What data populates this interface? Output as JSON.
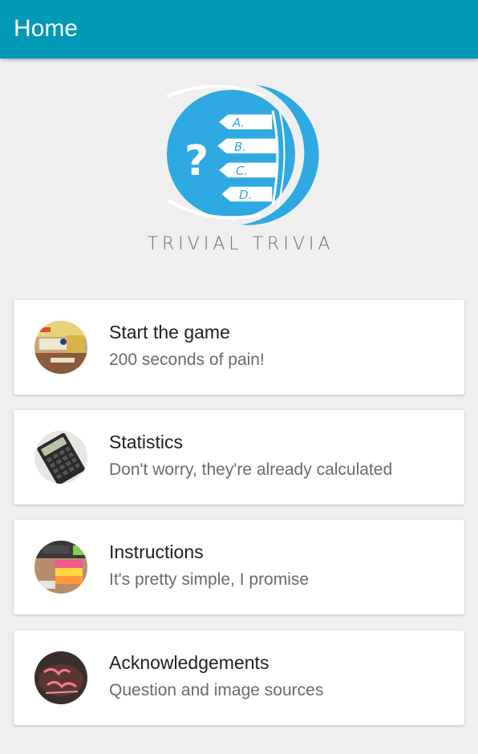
{
  "appbar": {
    "title": "Home",
    "color": "#0099b8"
  },
  "logo": {
    "text": "TRIVIAL TRIVIA",
    "question_mark": "?",
    "options": [
      "A.",
      "B.",
      "C.",
      "D."
    ],
    "color": "#2fa9e1"
  },
  "menu": {
    "items": [
      {
        "title": "Start the game",
        "subtitle": "200 seconds of pain!",
        "icon": "board-game-thumbnail"
      },
      {
        "title": "Statistics",
        "subtitle": "Don't worry, they're already calculated",
        "icon": "calculator-thumbnail"
      },
      {
        "title": "Instructions",
        "subtitle": "It's pretty simple, I promise",
        "icon": "sticky-notes-thumbnail"
      },
      {
        "title": "Acknowledgements",
        "subtitle": "Question and image sources",
        "icon": "thank-you-sign-thumbnail"
      }
    ]
  }
}
